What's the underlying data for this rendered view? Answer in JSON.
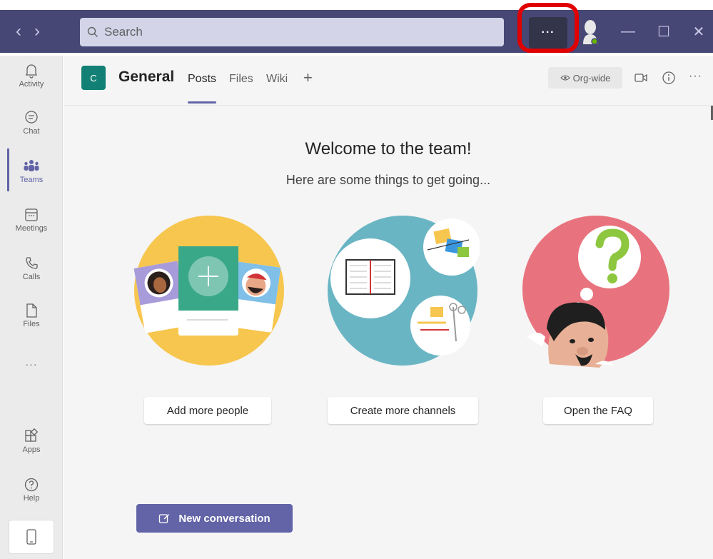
{
  "titlebar": {
    "back_icon": "chevron-left-icon",
    "forward_icon": "chevron-right-icon",
    "search_placeholder": "Search",
    "more_label": "···",
    "minimize_label": "—",
    "maximize_label": "☐",
    "close_label": "✕"
  },
  "rail": {
    "items": [
      {
        "label": "Activity",
        "icon": "bell-icon"
      },
      {
        "label": "Chat",
        "icon": "chat-icon"
      },
      {
        "label": "Teams",
        "icon": "teams-icon"
      },
      {
        "label": "Meetings",
        "icon": "calendar-icon"
      },
      {
        "label": "Calls",
        "icon": "phone-icon"
      },
      {
        "label": "Files",
        "icon": "file-icon"
      },
      {
        "label": "···",
        "icon": "more-icon"
      },
      {
        "label": "Apps",
        "icon": "apps-icon"
      },
      {
        "label": "Help",
        "icon": "help-icon"
      }
    ],
    "active_item": "Teams"
  },
  "header": {
    "team_initial": "C",
    "channel_name": "General",
    "tabs": [
      {
        "label": "Posts",
        "active": true
      },
      {
        "label": "Files",
        "active": false
      },
      {
        "label": "Wiki",
        "active": false
      }
    ],
    "add_tab_label": "+",
    "org_wide_label": "Org-wide"
  },
  "main": {
    "title": "Welcome to the team!",
    "subtitle": "Here are some things to get going...",
    "cards": [
      {
        "button": "Add more people"
      },
      {
        "button": "Create more channels"
      },
      {
        "button": "Open the FAQ"
      }
    ],
    "new_conversation_label": "New conversation"
  },
  "colors": {
    "titlebar": "#464775",
    "accent": "#6264a7",
    "highlight": "#e00000",
    "team_tile": "#128075"
  }
}
